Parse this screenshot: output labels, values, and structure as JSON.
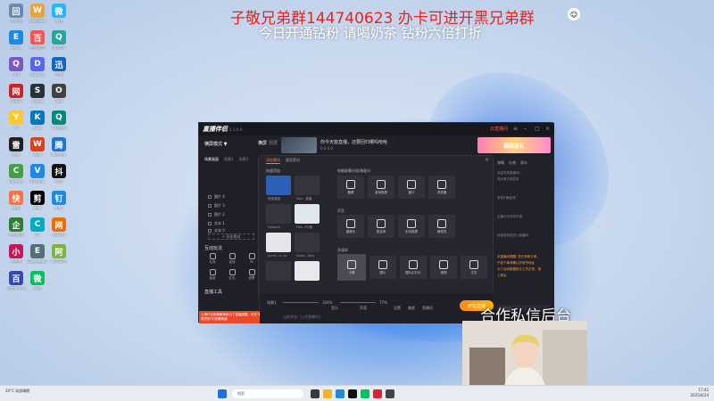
{
  "overlay": {
    "red_line": "子敬兄弟群144740623 办卡可进开黑兄弟群",
    "white_line": "今日开通钻粉 请喝奶茶 钻粉六倍打折",
    "cooperation": "合作私信后台"
  },
  "app": {
    "logo": "直播伴侣",
    "version": "5.1.0.4",
    "titlebar_red": "云直播间",
    "mode_button": "横屏模式 ▼",
    "tab_live": "横屏",
    "tab_plat": "竖屏",
    "stream_title": "你今天能直播，还要回归哪吗哈哈",
    "stream_meta": "0  0  0.0",
    "banner": "福袋送礼",
    "left_tabs": [
      "场景画面",
      "场景1",
      "场景2"
    ],
    "scene_items": [
      "图片 4",
      "图片 3",
      "图片 2",
      "文本 1",
      "文本 0"
    ],
    "add_source": "+ 添加素材",
    "interactive_title": "互动玩法",
    "interactive_tools": [
      "礼物",
      "连线",
      "PK",
      "抽奖",
      "红包",
      "投票"
    ],
    "tools_title": "直播工具",
    "red_note": "上海行业前警察局执行了直播提醒，可在\"管理员的\"中查看明细",
    "dialog": {
      "tabs": [
        "添加素材",
        "重要素材"
      ],
      "left_title": "快速添加",
      "right_title": "电脑屏幕分组/装配口",
      "picks": [
        "电脑桌面",
        "Dou...直播",
        "Fallback",
        "FNo...PC面",
        "jumin...e..ac",
        "mask...face",
        "DefaultV",
        ""
      ],
      "group1_title": "",
      "group1": [
        "截屏",
        "游戏投屏",
        "窗口",
        "浏览器"
      ],
      "group2_title": "声音",
      "group2": [
        "摄像头",
        "麦克风",
        "手机投屏",
        "网络流"
      ],
      "group3_title": "多媒体",
      "group3": [
        "卡牌",
        "图片",
        "图片幻灯片",
        "视频",
        "文字",
        "歌词/视频"
      ]
    },
    "bottom": {
      "scene_label": "场景1",
      "pct1": "104%",
      "label_bgm": "音乐",
      "pct2": "77%",
      "label_bgm2": "声音",
      "icons": [
        "设置",
        "美颜",
        "直播间"
      ],
      "start": "开始直播",
      "status": "当前状态: [上传直播中]"
    },
    "right": {
      "tabs": [
        "弹幕",
        "礼物",
        "观众"
      ],
      "lines": [
        "欢迎来到直播间！",
        "请大家文明发言",
        "",
        "",
        "老铁们刷起来",
        "",
        "",
        "主播今天状态不错",
        "",
        "",
        "欢迎新朋友进入直播间"
      ],
      "highlight_lines": [
        "本直播间提醒: 您已有新订单，",
        "产品下单请确认好收货地址",
        "为了活动数据统计工作正常，请",
        "上架后"
      ],
      "input_placeholder": "说点什么..."
    }
  },
  "taskbar": {
    "weather": "20°C 局部晴朗",
    "search_placeholder": "搜索",
    "time": "17:42",
    "date": "2025/4/24"
  },
  "desktop_icons": [
    "回收站",
    "WeGame",
    "微信",
    "Edge",
    "百度网盘",
    "QQ音乐",
    "QQ",
    "Discord",
    "迅雷",
    "网易云",
    "Steam",
    "OBS",
    "YY",
    "Kook",
    "QQ游戏",
    "雷神",
    "WPS",
    "腾讯会议",
    "Chrome",
    "VS Code",
    "抖音",
    "快手",
    "剪映",
    "钉钉",
    "企业微信",
    "CC",
    "网易UU",
    "小黑盒",
    "Everything",
    "阿里云盘",
    "百度输入法",
    "微信"
  ]
}
